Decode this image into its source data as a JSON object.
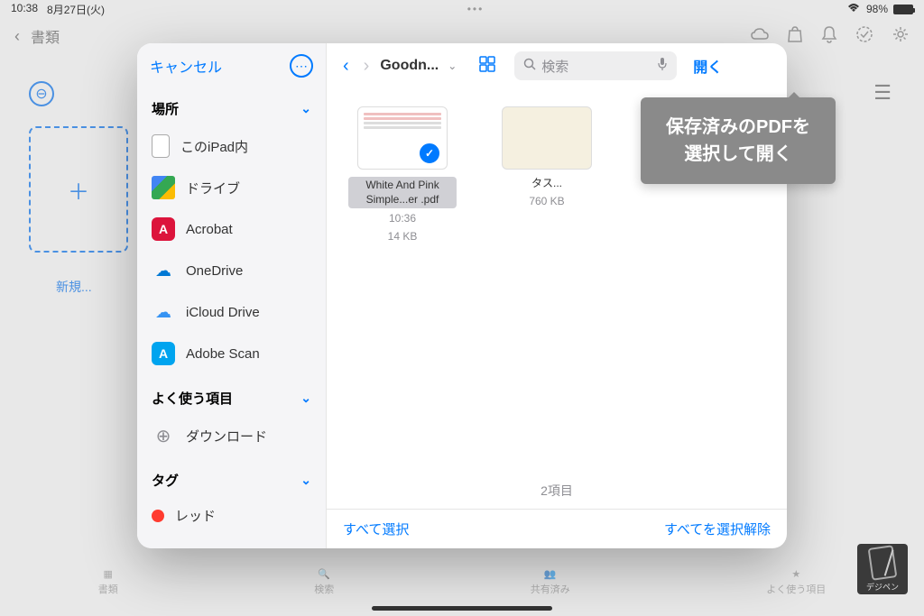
{
  "status": {
    "time": "10:38",
    "date": "8月27日(火)",
    "battery": "98%"
  },
  "app_header": {
    "back": "書類",
    "new": "新規..."
  },
  "modal": {
    "cancel": "キャンセル",
    "sections": {
      "locations": "場所",
      "favorites": "よく使う項目",
      "tags": "タグ"
    },
    "locations": [
      {
        "label": "このiPad内"
      },
      {
        "label": "ドライブ"
      },
      {
        "label": "Acrobat"
      },
      {
        "label": "OneDrive"
      },
      {
        "label": "iCloud Drive"
      },
      {
        "label": "Adobe Scan"
      }
    ],
    "favorites": [
      {
        "label": "ダウンロード"
      }
    ],
    "tags": [
      {
        "label": "レッド"
      }
    ],
    "breadcrumb": "Goodn...",
    "search_placeholder": "検索",
    "open": "開く",
    "files": [
      {
        "name": "White And Pink Simple...er .pdf",
        "time": "10:36",
        "size": "14 KB",
        "selected": true
      },
      {
        "name": "タス...",
        "size": "760 KB",
        "selected": false
      }
    ],
    "item_count": "2項目",
    "select_all": "すべて選択",
    "deselect_all": "すべてを選択解除"
  },
  "callout": {
    "line1": "保存済みのPDFを",
    "line2": "選択して開く"
  },
  "tabs": {
    "shelf": "書類",
    "search": "検索",
    "shared": "共有済み",
    "favorites": "よく使う項目"
  },
  "watermark": "デジペン"
}
